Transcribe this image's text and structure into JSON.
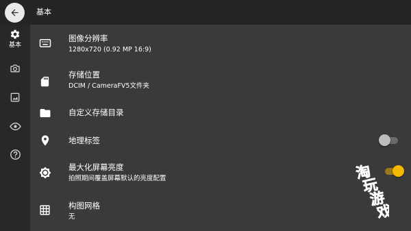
{
  "header": {
    "title": "基本",
    "back_icon": "arrow-back-icon"
  },
  "sidebar": {
    "items": [
      {
        "icon": "gear-icon",
        "label": "基本",
        "selected": true
      },
      {
        "icon": "camera-icon",
        "label": ""
      },
      {
        "icon": "image-icon",
        "label": ""
      },
      {
        "icon": "eye-icon",
        "label": ""
      },
      {
        "icon": "help-icon",
        "label": ""
      }
    ]
  },
  "settings": [
    {
      "icon": "keyboard-icon",
      "title": "图像分辨率",
      "subtitle": "1280x720 (0.92 MP 16:9)"
    },
    {
      "icon": "sd-card-icon",
      "title": "存储位置",
      "subtitle": "DCIM / CameraFV5文件夹"
    },
    {
      "icon": "folder-icon",
      "title": "自定义存储目录",
      "subtitle": ""
    },
    {
      "icon": "location-pin-icon",
      "title": "地理标签",
      "subtitle": "",
      "toggle": false
    },
    {
      "icon": "brightness-icon",
      "title": "最大化屏幕亮度",
      "subtitle": "拍照期间覆盖屏幕默认的亮度配置",
      "toggle": true
    },
    {
      "icon": "grid-icon",
      "title": "构图网格",
      "subtitle": "无"
    }
  ],
  "colors": {
    "toggle_on_thumb": "#f5b800",
    "toggle_on_track": "#9a7a1c",
    "toggle_off_thumb": "#bdbdbd",
    "toggle_off_track": "#6a6a6a",
    "background": "#3a3a3a",
    "sidebar": "#282828",
    "topbar": "#242424"
  },
  "watermark": {
    "text": "淘玩游戏"
  }
}
